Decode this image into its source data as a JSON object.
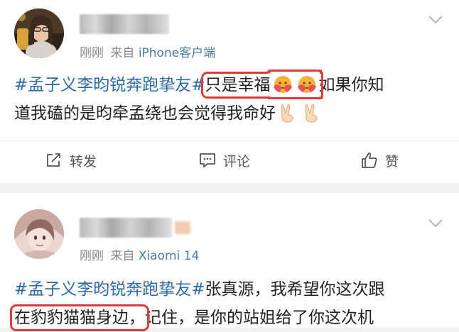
{
  "posts": [
    {
      "time": "刚刚",
      "source_prefix": "来自",
      "source": "iPhone客户端",
      "lines": [
        {
          "hashtag": "#孟子义李昀锐奔跑挚友#",
          "highlight": "只是幸福",
          "after": "如果你知"
        },
        {
          "text": "道我磕的是昀牵孟绕也会觉得我命好"
        }
      ],
      "actions": {
        "repost": "转发",
        "comment": "评论",
        "like": "赞"
      }
    },
    {
      "time": "刚刚",
      "source_prefix": "来自",
      "source": "Xiaomi 14",
      "lines": [
        {
          "hashtag": "#孟子义李昀锐奔跑挚友#",
          "text": "张真源，我希望你这次跟"
        },
        {
          "highlight": "在豹豹猫猫身边，",
          "after": "记住，是你的站姐给了你这次机"
        }
      ]
    }
  ],
  "icons": {
    "more": "chevron-down-icon",
    "repost": "share-square-icon",
    "comment": "comment-bubble-icon",
    "like": "thumbs-up-icon"
  },
  "colors": {
    "link": "#2c6aa6",
    "highlight_box": "#e03a3a",
    "meta": "#8a8a8a",
    "source": "#4a7aa8",
    "separator": "#f2f2f2"
  }
}
